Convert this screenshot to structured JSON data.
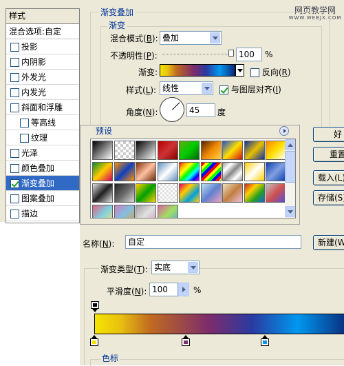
{
  "styles_panel": {
    "header": "样式",
    "blend_options": "混合选项:自定",
    "items": [
      {
        "label": "投影",
        "checked": false,
        "sub": false,
        "active": false
      },
      {
        "label": "内阴影",
        "checked": false,
        "sub": false,
        "active": false
      },
      {
        "label": "外发光",
        "checked": false,
        "sub": false,
        "active": false
      },
      {
        "label": "内发光",
        "checked": false,
        "sub": false,
        "active": false
      },
      {
        "label": "斜面和浮雕",
        "checked": false,
        "sub": false,
        "active": false
      },
      {
        "label": "等高线",
        "checked": false,
        "sub": true,
        "active": false
      },
      {
        "label": "纹理",
        "checked": false,
        "sub": true,
        "active": false
      },
      {
        "label": "光泽",
        "checked": false,
        "sub": false,
        "active": false
      },
      {
        "label": "颜色叠加",
        "checked": false,
        "sub": false,
        "active": false
      },
      {
        "label": "渐变叠加",
        "checked": true,
        "sub": false,
        "active": true
      },
      {
        "label": "图案叠加",
        "checked": false,
        "sub": false,
        "active": false
      },
      {
        "label": "描边",
        "checked": false,
        "sub": false,
        "active": false
      }
    ]
  },
  "watermark": {
    "line1": "网页教学网",
    "line2": "WWW.WEBJX.COM"
  },
  "gradient_overlay": {
    "section_title": "渐变叠加",
    "group_title": "渐变",
    "blend_mode_label": "混合模式(",
    "blend_mode_key": "B",
    "blend_mode_value": "叠加",
    "opacity_label": "不透明性(",
    "opacity_key": "P",
    "opacity_value": "100",
    "opacity_unit": "%",
    "opacity_level": 1.0,
    "gradient_label": "渐变:",
    "reverse_label": "反向(",
    "reverse_key": "R",
    "reverse_checked": false,
    "style_label": "样式(",
    "style_key": "L",
    "style_value": "线性",
    "align_label": "与图层对齐(",
    "align_key": "I",
    "align_checked": true,
    "angle_label": "角度(",
    "angle_key": "N",
    "angle_value": "45",
    "angle_unit": "度"
  },
  "presets": {
    "title": "预设",
    "swatches": [
      "linear-gradient(135deg,#000,#fff)",
      "repeating-conic-gradient(#ccc 0 25%,#fff 0 50%) 0 0/8px 8px",
      "linear-gradient(135deg,#000,#fff)",
      "linear-gradient(135deg,#b00,#c33,#800)",
      "linear-gradient(135deg,#6a1,#0c0,#060)",
      "linear-gradient(135deg,#520 0%,#e80 50%,#ffd24a 100%)",
      "linear-gradient(135deg,#2050d0,#ffe000,#d01010)",
      "linear-gradient(135deg,#1030a0,#e8c000,#1030a0)",
      "linear-gradient(135deg,#f80,#ffe000,#ffffff)",
      "linear-gradient(135deg,#0a8a2a,#ffcc00,#d00060)",
      "linear-gradient(135deg,#ff9000,#1040c0,#ff9000)",
      "linear-gradient(135deg,#803010,#ffc0a0,#6a2a10)",
      "linear-gradient(135deg,#6090c0,#ffffff,#6090c0)",
      "linear-gradient(135deg,red,orange,yellow,lime,cyan,blue,magenta)",
      "repeating-linear-gradient(135deg,red 0 4px,yellow 4px 8px,lime 8px 12px,blue 12px 16px)",
      "linear-gradient(135deg,#999,#fff,#888,#fff,#999)",
      "linear-gradient(135deg,#ffd000,#ffffff,#ffd000)",
      "linear-gradient(135deg,#1040b0,#80a0e0,#1040b0)",
      "linear-gradient(135deg,#e0e0e0,#202020,#e0e0e0)",
      "linear-gradient(135deg,#222,#6a6a6a,#d8d8d8)",
      "linear-gradient(135deg,#ffd000,#00a000,#ffd000)",
      "repeating-conic-gradient(#ddd 0 25%,#fff 0 50%) 0 0/6px 6px",
      "linear-gradient(135deg,#e00060,#ffcc00,#00a0e0,#ffd000)",
      "linear-gradient(135deg,#c0e0f0,#6080d0,#f0a0c0)",
      "linear-gradient(135deg,#f0e0c0,#c08040,#f0c0e0)",
      "linear-gradient(135deg,#d02020,#ffd000,#20a020,#2060e0)",
      "linear-gradient(135deg,#c0c0c0,#d05050,#5050d0)",
      "linear-gradient(135deg,#e06080,#80d0e0,#f0e080)",
      "linear-gradient(135deg,#d080c0,#80c0e0,#e0a040)",
      "linear-gradient(135deg,#a0a0a0,#e0e0e0,#d0a0c0)",
      "linear-gradient(135deg,#e060a0,#a0e060,#60a0e0)"
    ]
  },
  "name": {
    "label": "名称(",
    "key": "N",
    "value": "自定"
  },
  "gradient_type": {
    "label": "渐变类型(",
    "key": "T",
    "value": "实底"
  },
  "smoothness": {
    "label": "平滑度(",
    "key": "N",
    "value": "100",
    "unit": "%"
  },
  "colors": {
    "gradient_stops": [
      "#f4e300",
      "#7d2c6c",
      "#0096ee",
      "#0a1f5c"
    ],
    "bar_css": "linear-gradient(to right,#f5e400 0%,#e8c010 10%,#c06a20 22%,#7d2c6c 45%,#2a3aa0 62%,#0098ef 80%,#0a2a7a 100%)",
    "opacity_stop": "#000000",
    "stop_section_title": "色标"
  },
  "buttons": {
    "ok": "好",
    "reset": "重置",
    "load": "载入(L)...",
    "save": "存储(S)...",
    "new": "新建(W)"
  }
}
